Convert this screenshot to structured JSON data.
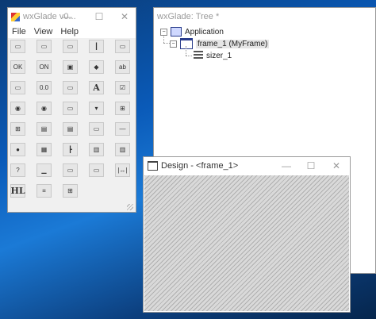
{
  "palette": {
    "title": "wxGlade v0...",
    "menu": [
      "File",
      "View",
      "Help"
    ],
    "tools": [
      {
        "name": "frame-tool",
        "glyph": "▭"
      },
      {
        "name": "dialog-tool",
        "glyph": "▭"
      },
      {
        "name": "panel-tool",
        "glyph": "▭"
      },
      {
        "name": "splitter-tool",
        "glyph": "┃"
      },
      {
        "name": "notebook-tool",
        "glyph": "▭"
      },
      {
        "name": "button-tool",
        "glyph": "OK"
      },
      {
        "name": "toggle-button-tool",
        "glyph": "ON"
      },
      {
        "name": "bitmap-button-tool",
        "glyph": "▣"
      },
      {
        "name": "spin-button-tool",
        "glyph": "◆"
      },
      {
        "name": "text-ctrl-tool",
        "glyph": "ab"
      },
      {
        "name": "combo-box-tool",
        "glyph": "▭"
      },
      {
        "name": "spin-ctrl-double-tool",
        "glyph": "0.0"
      },
      {
        "name": "spin-ctrl-tool",
        "glyph": "▭"
      },
      {
        "name": "static-text-tool",
        "glyph": "A"
      },
      {
        "name": "checkbox-tool",
        "glyph": "☑"
      },
      {
        "name": "radio-button-tool",
        "glyph": "◉"
      },
      {
        "name": "radio-box-tool",
        "glyph": "◉"
      },
      {
        "name": "choice-tool",
        "glyph": "▭"
      },
      {
        "name": "combo-tool",
        "glyph": "▾"
      },
      {
        "name": "slider-tool",
        "glyph": "⊞"
      },
      {
        "name": "grid-sizer-tool",
        "glyph": "⊞"
      },
      {
        "name": "list-box-tool",
        "glyph": "▤"
      },
      {
        "name": "list-ctrl-tool",
        "glyph": "▤"
      },
      {
        "name": "calendar-tool",
        "glyph": "▭"
      },
      {
        "name": "static-line-tool",
        "glyph": "―"
      },
      {
        "name": "color-picker-tool",
        "glyph": "●"
      },
      {
        "name": "grid-tool",
        "glyph": "▦"
      },
      {
        "name": "tree-ctrl-tool",
        "glyph": "┣"
      },
      {
        "name": "html-window-tool",
        "glyph": "▥"
      },
      {
        "name": "scroll-window-tool",
        "glyph": "▥"
      },
      {
        "name": "custom-widget-tool",
        "glyph": "?"
      },
      {
        "name": "gauge-tool",
        "glyph": "▁"
      },
      {
        "name": "static-box-tool",
        "glyph": "▭"
      },
      {
        "name": "empty-slot-tool",
        "glyph": "▭"
      },
      {
        "name": "spacer-tool",
        "glyph": "|↔|"
      },
      {
        "name": "hyperlink-tool",
        "glyph": "HL"
      },
      {
        "name": "box-sizer-tool",
        "glyph": "≡"
      },
      {
        "name": "flex-grid-sizer-tool",
        "glyph": "⊞"
      }
    ]
  },
  "tree": {
    "title": "wxGlade: Tree *",
    "application_label": "Application",
    "frame_label": "frame_1 (MyFrame)",
    "sizer_label": "sizer_1",
    "expander_open": "−"
  },
  "design": {
    "title": "Design - <frame_1>",
    "minimize": "—",
    "maximize": "☐",
    "close": "✕"
  },
  "colors": {
    "desktop": "#0a5ab8",
    "canvas_hatch": "#b0b0b0"
  }
}
